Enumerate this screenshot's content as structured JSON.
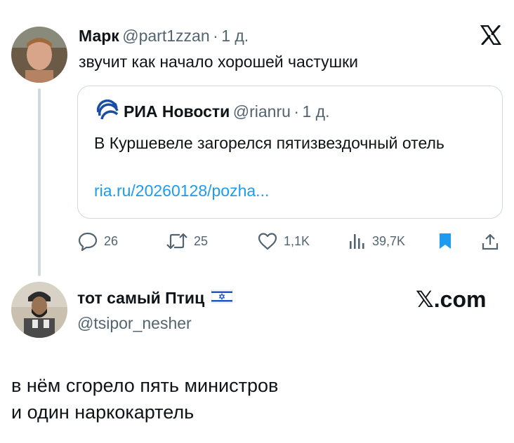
{
  "tweet": {
    "author_name": "Марк",
    "author_handle": "@part1zzan",
    "dot": "·",
    "time": "1 д.",
    "text": "звучит как начало хорошей частушки"
  },
  "quoted": {
    "author_name": "РИА Новости",
    "author_handle": "@rianru",
    "dot": "·",
    "time": "1 д.",
    "text": "В Куршевеле загорелся пятизвездочный отель",
    "link": "ria.ru/20260128/pozha..."
  },
  "actions": {
    "replies": "26",
    "retweets": "25",
    "likes": "1,1K",
    "views": "39,7K"
  },
  "reply_card": {
    "author_name": "тот самый Птиц",
    "author_handle": "@tsipor_nesher",
    "brand": "𝕏.com",
    "text_line1": "в нём сгорело пять министров",
    "text_line2": "и один наркокартель"
  },
  "icons": {
    "logo": "x-logo-icon",
    "quote_logo": "ria-logo-icon",
    "reply": "reply-icon",
    "retweet": "retweet-icon",
    "like": "heart-icon",
    "views": "views-icon",
    "bookmark": "bookmark-icon",
    "share": "share-icon",
    "flag": "israel-flag-icon"
  },
  "colors": {
    "link": "#1d9bf0",
    "bookmark": "#1d9bf0",
    "muted": "#536471",
    "border": "#cfd9de"
  }
}
